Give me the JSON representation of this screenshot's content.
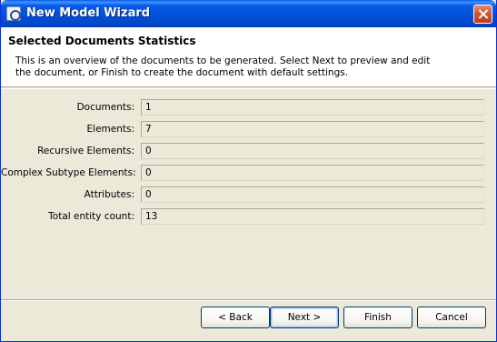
{
  "window": {
    "title": "New Model Wizard"
  },
  "header": {
    "title": "Selected Documents Statistics",
    "description": "This is an overview of the documents to be generated.  Select Next to preview and edit the document, or Finish to create the document with default settings."
  },
  "stats": [
    {
      "label": "Documents:",
      "value": "1"
    },
    {
      "label": "Elements:",
      "value": "7"
    },
    {
      "label": "Recursive Elements:",
      "value": "0"
    },
    {
      "label": "Complex Subtype Elements:",
      "value": "0"
    },
    {
      "label": "Attributes:",
      "value": "0"
    },
    {
      "label": "Total entity count:",
      "value": "13"
    }
  ],
  "buttons": {
    "back": "< Back",
    "next": "Next >",
    "finish": "Finish",
    "cancel": "Cancel"
  }
}
